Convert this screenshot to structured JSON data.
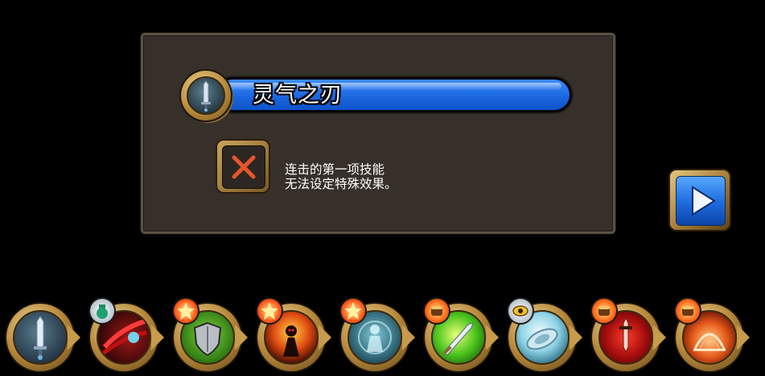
{
  "dialog": {
    "skill_name": "灵气之刃",
    "skill_icon": "sword-icon",
    "warning_icon": "cross-icon",
    "message_lines": [
      "连击的第一项技能",
      "无法设定特殊效果。"
    ]
  },
  "next_button": {
    "icon": "play-arrow-icon"
  },
  "skill_bar": {
    "slots": [
      {
        "name": "sword-skill",
        "icon": "sword-icon",
        "badge": null
      },
      {
        "name": "crimson-slash",
        "icon": "red-slash-icon",
        "badge": "potion-badge-icon"
      },
      {
        "name": "shield-guard",
        "icon": "shield-icon",
        "badge": "burst-badge-icon"
      },
      {
        "name": "shadow-strike",
        "icon": "dark-figure-icon",
        "badge": "burst-badge-icon"
      },
      {
        "name": "spirit-form",
        "icon": "spirit-figure-icon",
        "badge": "burst-badge-icon"
      },
      {
        "name": "green-blade",
        "icon": "green-blade-icon",
        "badge": "fist-badge-icon"
      },
      {
        "name": "ice-disc",
        "icon": "ice-disc-icon",
        "badge": "eye-badge-icon"
      },
      {
        "name": "blood-sword",
        "icon": "red-sword-icon",
        "badge": "fist-badge-icon"
      },
      {
        "name": "flame-dome",
        "icon": "flame-dome-icon",
        "badge": "fist-badge-icon"
      }
    ]
  },
  "colors": {
    "panel_bg": "#37302a",
    "name_bar_blue": "#1f6de6",
    "gold_frame": "#b98b3a",
    "warning_x": "#e8552a"
  }
}
